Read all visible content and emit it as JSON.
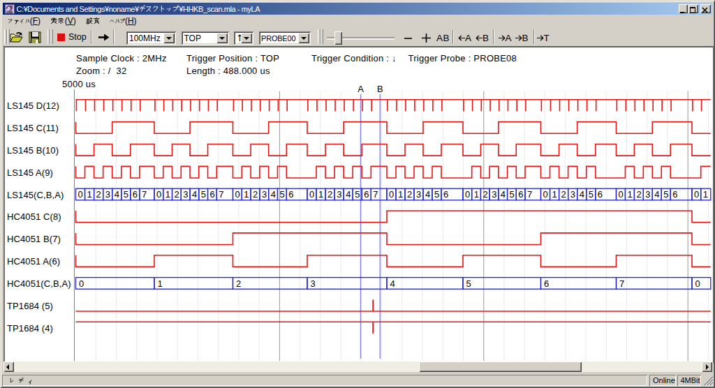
{
  "window": {
    "title": "C:¥Documents and Settings¥noname¥デスクトップ¥HHKB_scan.mla - myLA"
  },
  "menu": {
    "items": [
      {
        "id": "file",
        "label": "ファイル(F)"
      },
      {
        "id": "view",
        "label": "表示(V)"
      },
      {
        "id": "settings",
        "label": "設定"
      },
      {
        "id": "help",
        "label": "ヘルプ(H)"
      }
    ]
  },
  "toolbar": {
    "stop_label": "Stop",
    "run_arrow": "→",
    "clock_combo": "100MHz",
    "trigger_pos_combo": "TOP",
    "trigger_edge_combo": "↑",
    "probe_combo": "PROBE00",
    "zoom_out": "−",
    "zoom_in": "+",
    "zoom_ab": "AB",
    "to_a_left": "←A",
    "to_b_left": "←B",
    "to_a_right": "→A",
    "to_b_right": "→B",
    "to_trigger": "→T"
  },
  "info": {
    "sample_clock": "Sample Clock : 2MHz",
    "zoom": "Zoom : /  32",
    "trigger_position": "Trigger Position : TOP",
    "length": "Length : 488.000 us",
    "trigger_condition": "Trigger Condition : ↓",
    "trigger_probe": "Trigger Probe : PROBE08"
  },
  "statusbar": {
    "ready": "レディ",
    "online": "Online",
    "memory": "4MBit"
  },
  "scrollbar": {
    "thumb_left": 595.5,
    "thumb_width": 233
  },
  "chart_data": {
    "type": "logic-timing",
    "time_scale_label": "5000 us",
    "plot": {
      "x_start": 108.5,
      "x_end": 1017.8,
      "grid_top": 130.5,
      "grid_bottom": 517.5,
      "border_x": 106.5,
      "grid_spacing": 29.24,
      "dark_every": 10,
      "row_first_hi": 142.8,
      "row_pitch": 31.85,
      "row_amplitude": 16.6
    },
    "cursors": [
      {
        "name": "A",
        "x": 516.5
      },
      {
        "name": "B",
        "x": 544.3
      }
    ],
    "cycles": [
      {
        "start": 108.5,
        "count": 8,
        "last_start": 199.9
      },
      {
        "start": 221.0,
        "count": 8,
        "last_start": 310.3
      },
      {
        "start": 333.5,
        "count": 7,
        "last_start": 410.3
      },
      {
        "start": 440.0,
        "count": 8,
        "last_start": 531.3
      },
      {
        "start": 554.0,
        "count": 7,
        "last_start": 632.0
      },
      {
        "start": 663.0,
        "count": 8,
        "last_start": 752.0
      },
      {
        "start": 774.5,
        "count": 7,
        "last_start": 852.8
      },
      {
        "start": 882.5,
        "count": 7,
        "last_start": 960.2
      },
      {
        "start": 991.0,
        "count": 2,
        "last_start": 1003.7
      }
    ],
    "hc_values": [
      0,
      1,
      2,
      3,
      4,
      5,
      6,
      7,
      0
    ],
    "signals": [
      {
        "label": "LS145 D(12)",
        "kind": "strobe"
      },
      {
        "label": "LS145 C(11)",
        "kind": "ls_bit",
        "bit": 2
      },
      {
        "label": "LS145 B(10)",
        "kind": "ls_bit",
        "bit": 1
      },
      {
        "label": "LS145 A(9)",
        "kind": "ls_bit",
        "bit": 0
      },
      {
        "label": "LS145(C,B,A)",
        "kind": "ls_bus"
      },
      {
        "label": "HC4051 C(8)",
        "kind": "hc_bit",
        "bit": 2
      },
      {
        "label": "HC4051 B(7)",
        "kind": "hc_bit",
        "bit": 1
      },
      {
        "label": "HC4051 A(6)",
        "kind": "hc_bit",
        "bit": 0
      },
      {
        "label": "HC4051(C,B,A)",
        "kind": "hc_bus"
      },
      {
        "label": "TP1684 (5)",
        "kind": "pulse",
        "rest_level": 0,
        "pulse_x": 534.3
      },
      {
        "label": "TP1684 (4)",
        "kind": "pulse",
        "rest_level": 1,
        "pulse_x": 534.3
      }
    ]
  },
  "colors": {
    "signal": "#e81414",
    "bus": "#2222cc",
    "cursor": "#8888dd",
    "grid_light": "#eaeaea",
    "grid_dark": "#999999",
    "title_grad_left": "#0a246a",
    "title_grad_right": "#a6caf0",
    "chrome": "#d4d0c8"
  }
}
